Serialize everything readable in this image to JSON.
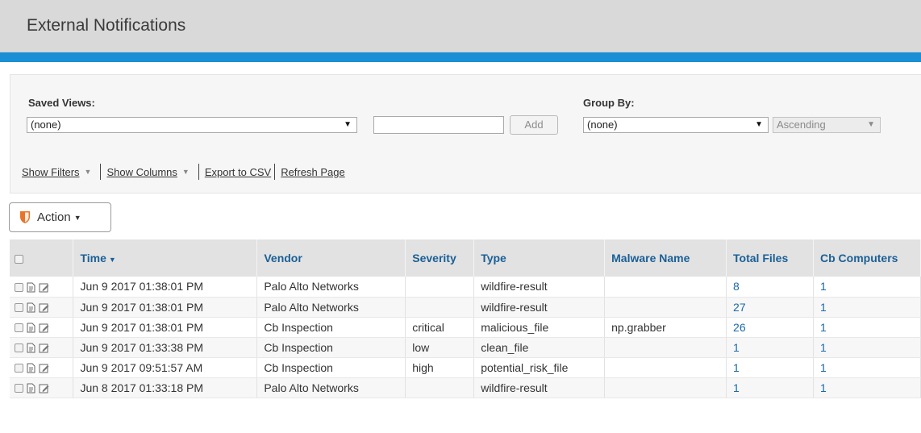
{
  "header": {
    "title": "External Notifications"
  },
  "filters": {
    "saved_views_label": "Saved Views:",
    "saved_views_value": "(none)",
    "view_name_value": "",
    "add_label": "Add",
    "group_by_label": "Group By:",
    "group_by_value": "(none)",
    "order_value": "Ascending"
  },
  "links": {
    "show_filters": "Show Filters",
    "show_columns": "Show Columns",
    "export_csv": "Export to CSV",
    "refresh_page": "Refresh Page"
  },
  "action": {
    "label": "Action"
  },
  "table": {
    "columns": [
      "Time",
      "Vendor",
      "Severity",
      "Type",
      "Malware Name",
      "Total Files",
      "Cb Computers"
    ],
    "rows": [
      [
        "Jun 9 2017 01:38:01 PM",
        "Palo Alto Networks",
        "",
        "wildfire-result",
        "",
        "8",
        "1"
      ],
      [
        "Jun 9 2017 01:38:01 PM",
        "Palo Alto Networks",
        "",
        "wildfire-result",
        "",
        "27",
        "1"
      ],
      [
        "Jun 9 2017 01:38:01 PM",
        "Cb Inspection",
        "critical",
        "malicious_file",
        "np.grabber",
        "26",
        "1"
      ],
      [
        "Jun 9 2017 01:33:38 PM",
        "Cb Inspection",
        "low",
        "clean_file",
        "",
        "1",
        "1"
      ],
      [
        "Jun 9 2017 09:51:57 AM",
        "Cb Inspection",
        "high",
        "potential_risk_file",
        "",
        "1",
        "1"
      ],
      [
        "Jun 8 2017 01:33:18 PM",
        "Palo Alto Networks",
        "",
        "wildfire-result",
        "",
        "1",
        "1"
      ]
    ]
  },
  "colors": {
    "accent_bar": "#1a8fd6",
    "header_bg": "#d9d9d9",
    "column_header_text": "#1a5f96",
    "shield_icon": "#e8742a"
  }
}
